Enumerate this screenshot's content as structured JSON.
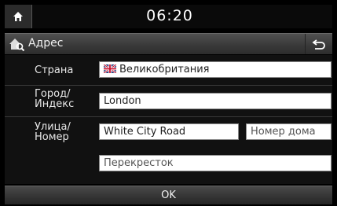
{
  "status_bar": {
    "time": "06:20"
  },
  "header": {
    "title": "Адрес"
  },
  "form": {
    "country_label": "Страна",
    "country_value": "Великобритания",
    "city_label_line1": "Город/",
    "city_label_line2": "Индекс",
    "city_value": "London",
    "street_label_line1": "Улица/",
    "street_label_line2": "Номер",
    "street_value": "White City Road",
    "house_number_placeholder": "Номер дома",
    "crossroad_placeholder": "Перекресток"
  },
  "footer": {
    "ok_label": "OK"
  },
  "icons": {
    "home": "home-icon",
    "address": "house-search-icon",
    "back": "back-arrow-icon",
    "flag": "uk-flag-icon"
  }
}
